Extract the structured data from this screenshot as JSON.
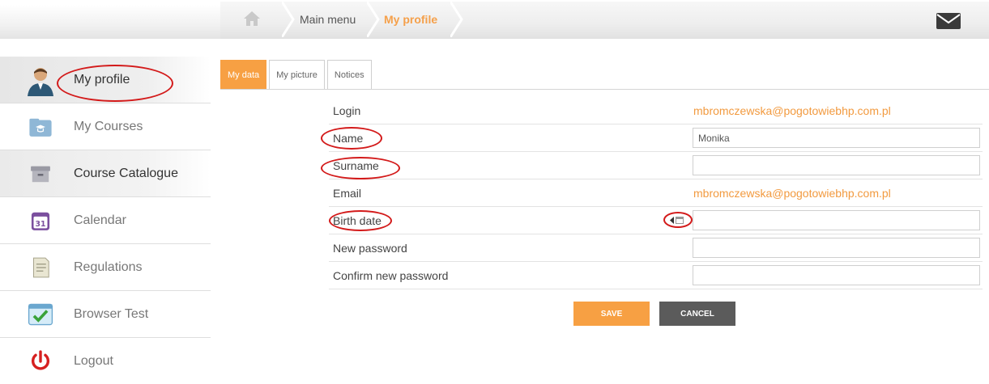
{
  "breadcrumb": {
    "home_icon": "home-icon",
    "items": [
      "Main menu",
      "My profile"
    ]
  },
  "header": {
    "mail_icon": "envelope-icon"
  },
  "sidebar": {
    "items": [
      {
        "label": "My profile",
        "icon": "user-avatar-icon"
      },
      {
        "label": "My Courses",
        "icon": "folder-icon"
      },
      {
        "label": "Course Catalogue",
        "icon": "archive-box-icon"
      },
      {
        "label": "Calendar",
        "icon": "calendar-icon"
      },
      {
        "label": "Regulations",
        "icon": "document-icon"
      },
      {
        "label": "Browser Test",
        "icon": "browser-check-icon"
      },
      {
        "label": "Logout",
        "icon": "power-icon"
      }
    ]
  },
  "tabs": [
    {
      "label": "My data",
      "active": true
    },
    {
      "label": "My picture",
      "active": false
    },
    {
      "label": "Notices",
      "active": false
    }
  ],
  "form": {
    "login_label": "Login",
    "login_value": "mbromczewska@pogotowiebhp.com.pl",
    "name_label": "Name",
    "name_value": "Monika",
    "surname_label": "Surname",
    "surname_value": "",
    "email_label": "Email",
    "email_value": "mbromczewska@pogotowiebhp.com.pl",
    "birth_label": "Birth date",
    "birth_value": "",
    "new_password_label": "New password",
    "confirm_password_label": "Confirm new password"
  },
  "buttons": {
    "save": "SAVE",
    "cancel": "CANCEL"
  },
  "colors": {
    "accent": "#f7a043",
    "dark_button": "#5b5b5b",
    "annotation": "#d31a1a"
  }
}
